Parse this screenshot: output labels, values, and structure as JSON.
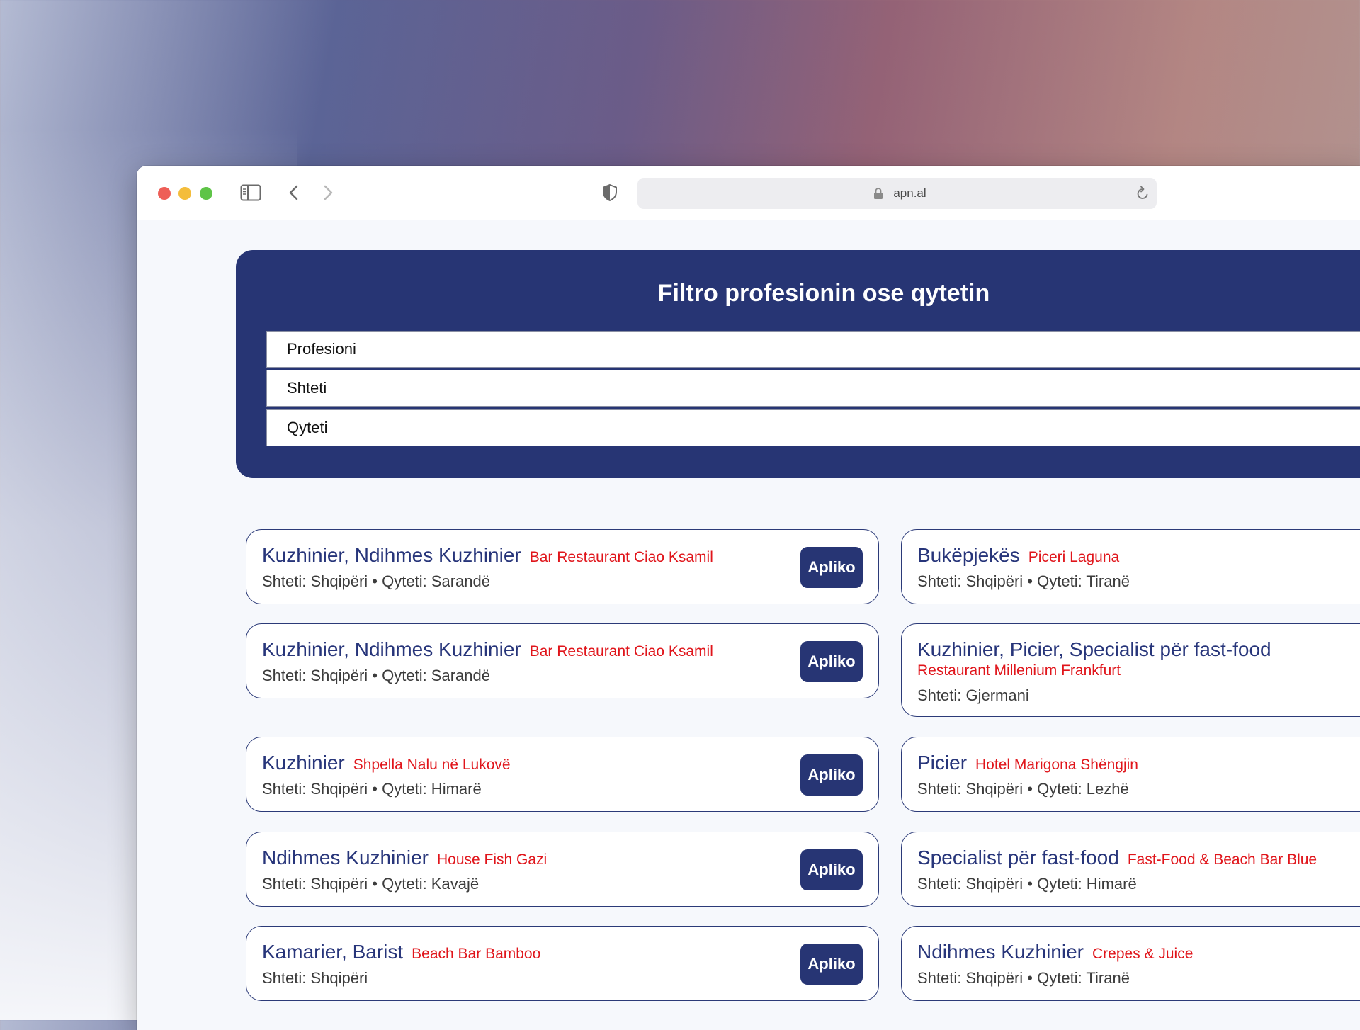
{
  "browser": {
    "url": "apn.al"
  },
  "filter": {
    "title": "Filtro profesionin ose qytetin",
    "profession_placeholder": "Profesioni",
    "country_placeholder": "Shteti",
    "city_placeholder": "Qyteti"
  },
  "apply_label": "Apliko",
  "jobs": [
    {
      "title": "Kuzhinier, Ndihmes Kuzhinier",
      "company": "Bar Restaurant Ciao Ksamil",
      "location": "Shteti: Shqipëri • Qyteti: Sarandë"
    },
    {
      "title": "Bukëpjekës",
      "company": "Piceri Laguna",
      "location": "Shteti: Shqipëri • Qyteti: Tiranë"
    },
    {
      "title": "Kuzhinier, Ndihmes Kuzhinier",
      "company": "Bar Restaurant Ciao Ksamil",
      "location": "Shteti: Shqipëri • Qyteti: Sarandë"
    },
    {
      "title": "Kuzhinier, Picier, Specialist për fast-food",
      "company": "Restaurant Millenium Frankfurt",
      "location": "Shteti: Gjermani"
    },
    {
      "title": "Kuzhinier",
      "company": "Shpella Nalu në Lukovë",
      "location": "Shteti: Shqipëri • Qyteti: Himarë"
    },
    {
      "title": "Picier",
      "company": "Hotel Marigona Shëngjin",
      "location": "Shteti: Shqipëri • Qyteti: Lezhë"
    },
    {
      "title": "Ndihmes Kuzhinier",
      "company": "House Fish Gazi",
      "location": "Shteti: Shqipëri • Qyteti: Kavajë"
    },
    {
      "title": "Specialist për fast-food",
      "company": "Fast-Food & Beach Bar Blue",
      "location": "Shteti: Shqipëri • Qyteti: Himarë"
    },
    {
      "title": "Kamarier, Barist",
      "company": "Beach Bar Bamboo",
      "location": "Shteti: Shqipëri"
    },
    {
      "title": "Ndihmes Kuzhinier",
      "company": "Crepes & Juice",
      "location": "Shteti: Shqipëri • Qyteti: Tiranë"
    }
  ],
  "colors": {
    "brand_navy": "#273574",
    "company_red": "#e0151b"
  }
}
